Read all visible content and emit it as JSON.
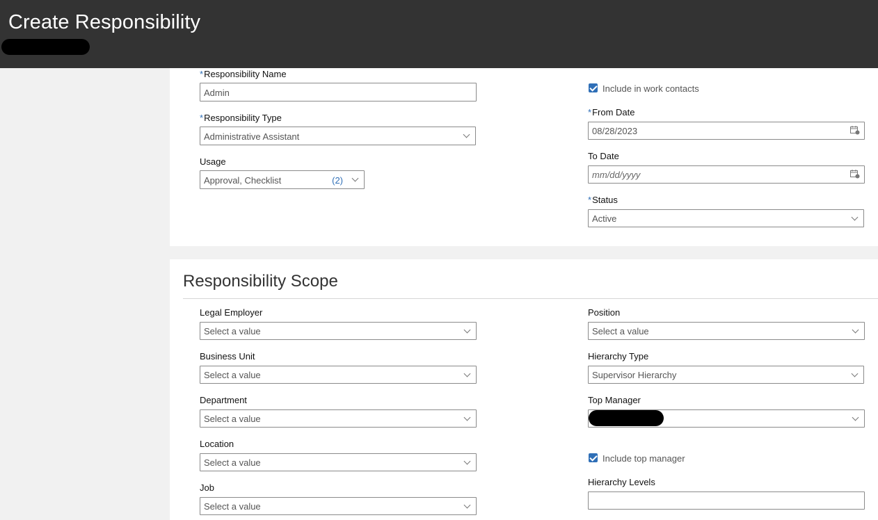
{
  "header": {
    "title": "Create Responsibility"
  },
  "basic": {
    "responsibility_name": {
      "label": "Responsibility Name",
      "value": "Admin"
    },
    "responsibility_type": {
      "label": "Responsibility Type",
      "value": "Administrative Assistant"
    },
    "usage": {
      "label": "Usage",
      "value": "Approval, Checklist",
      "count": "(2)"
    },
    "include_work_contacts": {
      "label": "Include in work contacts",
      "checked": true
    },
    "from_date": {
      "label": "From Date",
      "value": "08/28/2023"
    },
    "to_date": {
      "label": "To Date",
      "placeholder": "mm/dd/yyyy"
    },
    "status": {
      "label": "Status",
      "value": "Active"
    }
  },
  "scope": {
    "title": "Responsibility Scope",
    "legal_employer": {
      "label": "Legal Employer",
      "placeholder": "Select a value"
    },
    "business_unit": {
      "label": "Business Unit",
      "placeholder": "Select a value"
    },
    "department": {
      "label": "Department",
      "placeholder": "Select a value"
    },
    "location": {
      "label": "Location",
      "placeholder": "Select a value"
    },
    "job": {
      "label": "Job",
      "placeholder": "Select a value"
    },
    "position": {
      "label": "Position",
      "placeholder": "Select a value"
    },
    "hierarchy_type": {
      "label": "Hierarchy Type",
      "value": "Supervisor Hierarchy"
    },
    "top_manager": {
      "label": "Top Manager"
    },
    "include_top_manager": {
      "label": "Include top manager",
      "checked": true
    },
    "hierarchy_levels": {
      "label": "Hierarchy Levels",
      "value": ""
    }
  },
  "icons": {
    "calendar": "calendar-icon",
    "dropdown": "chevron-down-icon",
    "checkbox": "checkmark-icon"
  },
  "colors": {
    "header_bg": "#333333",
    "accent": "#2f6fb7",
    "page_bg": "#f1f1f1"
  },
  "required_marker": "*"
}
